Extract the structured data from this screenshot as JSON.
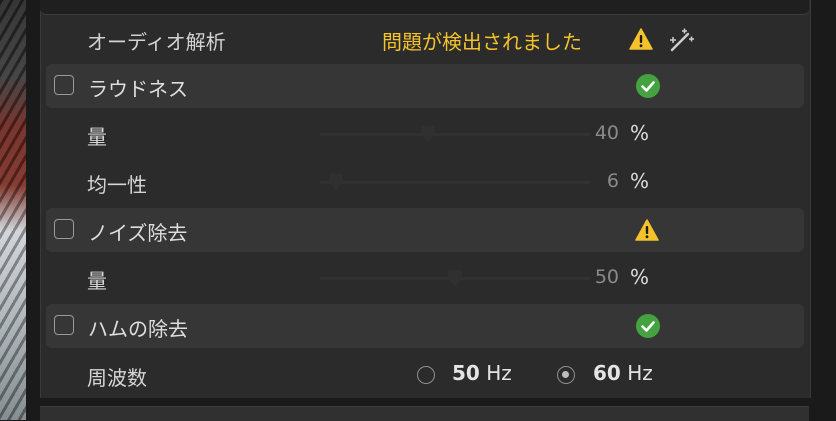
{
  "colors": {
    "panel_bg": "#2b2b2b",
    "section_bg": "#363636",
    "warning": "#f4c22b",
    "ok": "#44a340"
  },
  "header": {
    "title": "オーディオ解析",
    "status": "問題が検出されました",
    "status_icon": "warning-icon",
    "action_icon": "magic-wand-icon"
  },
  "sections": [
    {
      "label": "ラウドネス",
      "checked": false,
      "status_icon": "check-circle-icon",
      "params": [
        {
          "label": "量",
          "value": "40",
          "unit": "%",
          "level": 0.4
        },
        {
          "label": "均一性",
          "value": "6",
          "unit": "%",
          "level": 0.06
        }
      ]
    },
    {
      "label": "ノイズ除去",
      "checked": false,
      "status_icon": "warning-icon",
      "params": [
        {
          "label": "量",
          "value": "50",
          "unit": "%",
          "level": 0.5
        }
      ]
    },
    {
      "label": "ハムの除去",
      "checked": false,
      "status_icon": "check-circle-icon",
      "frequency": {
        "label": "周波数",
        "options": [
          {
            "number": "50",
            "unit": "Hz",
            "selected": false
          },
          {
            "number": "60",
            "unit": "Hz",
            "selected": true
          }
        ]
      }
    }
  ]
}
